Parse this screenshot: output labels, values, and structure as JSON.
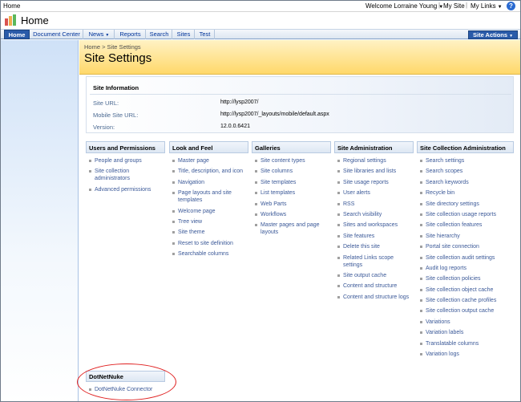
{
  "topbar": {
    "home": "Home",
    "welcome": "Welcome Lorraine Young",
    "sep1": "|",
    "my_site": "My Site",
    "sep2": "|",
    "my_links": "My Links",
    "help_glyph": "?"
  },
  "header": {
    "site_title": "Home"
  },
  "nav": {
    "tabs": [
      {
        "label": "Home"
      },
      {
        "label": "Document Center"
      },
      {
        "label": "News"
      },
      {
        "label": "Reports"
      },
      {
        "label": "Search"
      },
      {
        "label": "Sites"
      },
      {
        "label": "Test"
      }
    ],
    "site_actions": "Site Actions"
  },
  "page": {
    "breadcrumb": "Home > Site Settings",
    "title": "Site Settings"
  },
  "site_info": {
    "header": "Site Information",
    "rows": [
      {
        "label": "Site URL:",
        "value": "http://lysp2007/"
      },
      {
        "label": "Mobile Site URL:",
        "value": "http://lysp2007/_layouts/mobile/default.aspx"
      },
      {
        "label": "Version:",
        "value": "12.0.0.6421"
      }
    ]
  },
  "sections": [
    {
      "title": "Users and Permissions",
      "links": [
        "People and groups",
        "Site collection administrators",
        "Advanced permissions"
      ]
    },
    {
      "title": "Look and Feel",
      "links": [
        "Master page",
        "Title, description, and icon",
        "Navigation",
        "Page layouts and site templates",
        "Welcome page",
        "Tree view",
        "Site theme",
        "Reset to site definition",
        "Searchable columns"
      ]
    },
    {
      "title": "Galleries",
      "links": [
        "Site content types",
        "Site columns",
        "Site templates",
        "List templates",
        "Web Parts",
        "Workflows",
        "Master pages and page layouts"
      ]
    },
    {
      "title": "Site Administration",
      "links": [
        "Regional settings",
        "Site libraries and lists",
        "Site usage reports",
        "User alerts",
        "RSS",
        "Search visibility",
        "Sites and workspaces",
        "Site features",
        "Delete this site",
        "Related Links scope settings",
        "Site output cache",
        "Content and structure",
        "Content and structure logs"
      ]
    },
    {
      "title": "Site Collection Administration",
      "links": [
        "Search settings",
        "Search scopes",
        "Search keywords",
        "Recycle bin",
        "Site directory settings",
        "Site collection usage reports",
        "Site collection features",
        "Site hierarchy",
        "Portal site connection",
        "Site collection audit settings",
        "Audit log reports",
        "Site collection policies",
        "Site collection object cache",
        "Site collection cache profiles",
        "Site collection output cache",
        "Variations",
        "Variation labels",
        "Translatable columns",
        "Variation logs"
      ]
    }
  ],
  "dotnetnuke": {
    "title": "DotNetNuke",
    "links": [
      "DotNetNuke Connector"
    ]
  },
  "colors": {
    "accent": "#2a5ba9",
    "link": "#3b5998",
    "page_header": "#ffd86a",
    "highlight": "#e02020"
  }
}
